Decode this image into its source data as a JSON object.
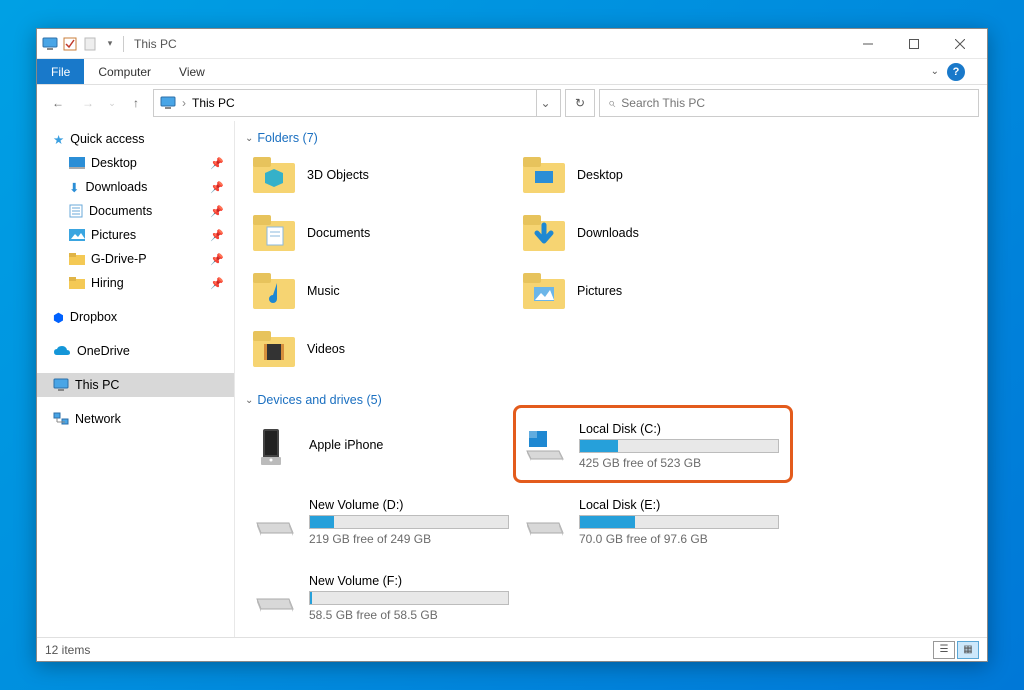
{
  "title": "This PC",
  "ribbon": {
    "file": "File",
    "computer": "Computer",
    "view": "View"
  },
  "addressbar": {
    "location": "This PC",
    "separator": "›"
  },
  "search": {
    "placeholder": "Search This PC"
  },
  "sidebar": {
    "quick_access": "Quick access",
    "items": [
      {
        "label": "Desktop",
        "pinned": true
      },
      {
        "label": "Downloads",
        "pinned": true
      },
      {
        "label": "Documents",
        "pinned": true
      },
      {
        "label": "Pictures",
        "pinned": true
      },
      {
        "label": "G-Drive-P",
        "pinned": true
      },
      {
        "label": "Hiring",
        "pinned": true
      }
    ],
    "dropbox": "Dropbox",
    "onedrive": "OneDrive",
    "thispc": "This PC",
    "network": "Network"
  },
  "sections": {
    "folders": {
      "title": "Folders (7)"
    },
    "drives": {
      "title": "Devices and drives (5)"
    }
  },
  "folders": [
    {
      "label": "3D Objects"
    },
    {
      "label": "Desktop"
    },
    {
      "label": "Documents"
    },
    {
      "label": "Downloads"
    },
    {
      "label": "Music"
    },
    {
      "label": "Pictures"
    },
    {
      "label": "Videos"
    }
  ],
  "drives": [
    {
      "label": "Apple iPhone",
      "type": "device"
    },
    {
      "label": "Local Disk (C:)",
      "free": "425 GB free of 523 GB",
      "used_pct": 19,
      "highlighted": true
    },
    {
      "label": "New Volume (D:)",
      "free": "219 GB free of 249 GB",
      "used_pct": 12
    },
    {
      "label": "Local Disk (E:)",
      "free": "70.0 GB free of 97.6 GB",
      "used_pct": 28
    },
    {
      "label": "New Volume (F:)",
      "free": "58.5 GB free of 58.5 GB",
      "used_pct": 0.3
    }
  ],
  "statusbar": {
    "count": "12 items"
  },
  "colors": {
    "accent": "#1979ca",
    "highlight": "#e35b1c",
    "drive_fill": "#26a0da"
  }
}
